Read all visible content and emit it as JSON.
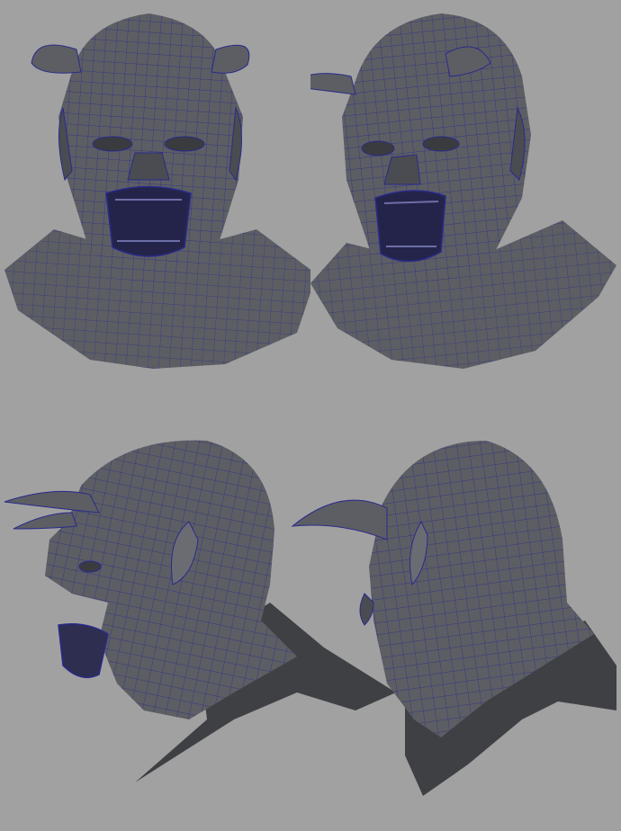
{
  "viewport": {
    "background": "#a1a1a1"
  },
  "style": {
    "mesh_fill": "#5c5e63",
    "mesh_shadow": "#3a3b3f",
    "mesh_highlight": "#7a7c82",
    "wire_color": "#2a2a8c"
  },
  "views": [
    {
      "name": "front-view"
    },
    {
      "name": "three-quarter-view"
    },
    {
      "name": "side-view"
    },
    {
      "name": "back-three-quarter-view"
    }
  ]
}
